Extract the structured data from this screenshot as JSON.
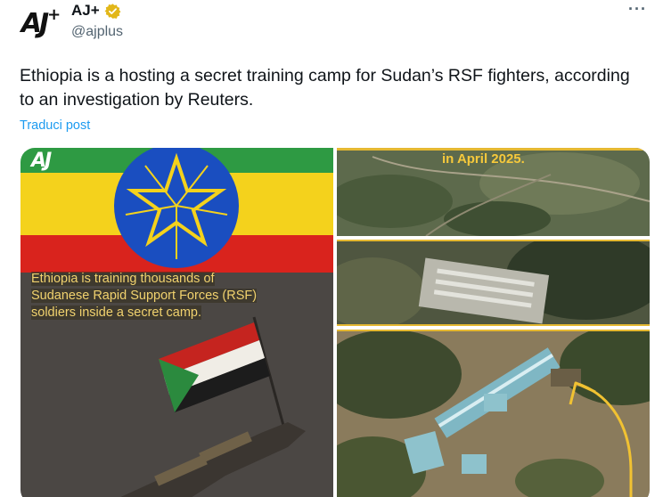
{
  "author": {
    "avatar_text": "AJ",
    "avatar_plus": "+",
    "display_name": "AJ+",
    "handle": "@ajplus",
    "verified_icon": "verified-badge-icon",
    "more_icon": "more-options-icon"
  },
  "post": {
    "text": "Ethiopia is a hosting a secret training camp for Sudan’s RSF fighters, according to an investigation by Reuters.",
    "translate_label": "Traduci post"
  },
  "media": {
    "left_image": {
      "logo_mark": "AJ",
      "caption": "Ethiopia is training thousands of Sudanese Rapid Support Forces (RSF) soldiers inside a secret camp."
    },
    "right_images": {
      "top_label": "in April 2025."
    }
  },
  "colors": {
    "link_blue": "#1d9bf0",
    "verified_gold": "#e2b719",
    "caption_yellow": "#f1d26e",
    "annotation_yellow": "#f6c93b"
  }
}
